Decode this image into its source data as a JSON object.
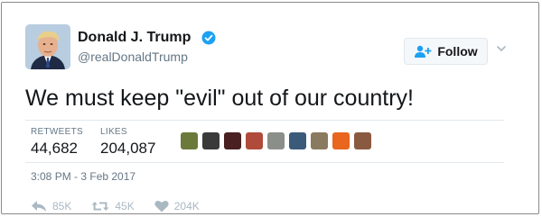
{
  "tweet": {
    "author_name": "Donald J. Trump",
    "handle": "@realDonaldTrump",
    "text": "We must keep \"evil\" out of our country!",
    "timestamp": "3:08 PM - 3 Feb 2017"
  },
  "follow_button": {
    "label": "Follow"
  },
  "stats": {
    "retweets_label": "RETWEETS",
    "retweets_value": "44,682",
    "likes_label": "LIKES",
    "likes_value": "204,087"
  },
  "liked_by_avatars": [
    {
      "name": "liker-avatar-1",
      "color": "#6b7a3a"
    },
    {
      "name": "liker-avatar-2",
      "color": "#3a3a3a"
    },
    {
      "name": "liker-avatar-3",
      "color": "#4a2020"
    },
    {
      "name": "liker-avatar-4",
      "color": "#b04a3a"
    },
    {
      "name": "liker-avatar-5",
      "color": "#8a8f8a"
    },
    {
      "name": "liker-avatar-6",
      "color": "#3a5a7a"
    },
    {
      "name": "liker-avatar-7",
      "color": "#8a7a60"
    },
    {
      "name": "liker-avatar-8",
      "color": "#e8661e"
    },
    {
      "name": "liker-avatar-9",
      "color": "#8a5a40"
    }
  ],
  "actions": {
    "reply_count": "85K",
    "retweet_count": "45K",
    "like_count": "204K"
  },
  "colors": {
    "verified_blue": "#1da1f2",
    "text_primary": "#14171a",
    "text_secondary": "#657786",
    "action_gray": "#aab8c2"
  },
  "icons": [
    "verified-icon",
    "add-user-icon",
    "chevron-down-icon",
    "reply-icon",
    "retweet-icon",
    "heart-icon"
  ]
}
